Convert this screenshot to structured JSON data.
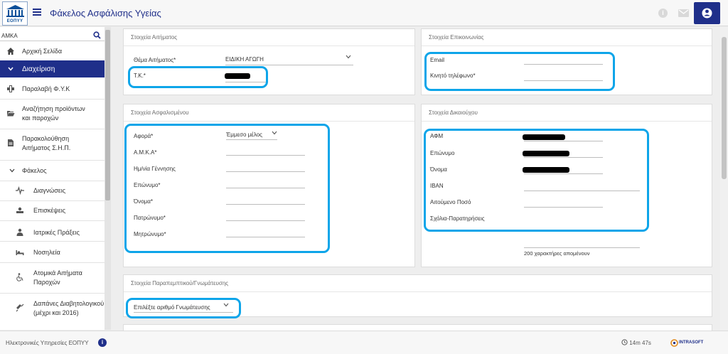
{
  "app": {
    "logo_text": "ΕΟΠΥΥ",
    "title": "Φάκελος Ασφάλισης Υγείας"
  },
  "sidebar": {
    "search_label": "ΑΜΚΑ",
    "items": [
      {
        "label": "Αρχική Σελίδα",
        "icon": "home-icon"
      },
      {
        "label": "Διαχείριση",
        "icon": "chevron-down-icon"
      },
      {
        "label": "Παραλαβή Φ.Υ.Κ",
        "icon": "pharmacy-icon"
      },
      {
        "label_line1": "Αναζήτηση προϊόντων",
        "label_line2": "και παροχών",
        "icon": "folder-open-icon"
      },
      {
        "label_line1": "Παρακολούθηση",
        "label_line2": "Αιτήματος Σ.Η.Π.",
        "icon": "document-icon"
      },
      {
        "label": "Φάκελος",
        "icon": "chevron-down-icon"
      },
      {
        "label": "Διαγνώσεις",
        "icon": "pulse-icon"
      },
      {
        "label": "Επισκέψεις",
        "icon": "visit-icon"
      },
      {
        "label": "Ιατρικές Πράξεις",
        "icon": "medical-acts-icon"
      },
      {
        "label": "Νοσηλεία",
        "icon": "bed-icon"
      },
      {
        "label_line1": "Ατομικά Αιτήματα",
        "label_line2": "Παροχών",
        "icon": "wheelchair-icon"
      },
      {
        "label_line1": "Δαπάνες Διαβητολογικού",
        "label_line2": "(μέχρι και 2016)",
        "icon": "syringe-icon"
      }
    ]
  },
  "request": {
    "title": "Στοιχεία Αιτήματος",
    "subject_label": "Θέμα Αιτήματος*",
    "subject_value": "ΕΙΔΙΚΗ ΑΓΩΓΗ",
    "postal_label": "Τ.Κ.*"
  },
  "contact": {
    "title": "Στοιχεία Επικοινωνίας",
    "email_label": "Email",
    "mobile_label": "Κινητό τηλέφωνο*"
  },
  "insured": {
    "title": "Στοιχεία Ασφαλισμένου",
    "concerns_label": "Αφορά*",
    "concerns_value": "Έμμεσο μέλος",
    "fields": [
      "Α.Μ.Κ.Α*",
      "Ημ/νία Γέννησης",
      "Επώνυμο*",
      "Όνομα*",
      "Πατρώνυμο*",
      "Μητρώνυμο*"
    ]
  },
  "beneficiary": {
    "title": "Στοιχεία Δικαιούχου",
    "fields": [
      "ΑΦΜ",
      "Επώνυμο",
      "Όνομα",
      "IBAN",
      "Αιτούμενο Ποσό",
      "Σχόλια-Παρατηρήσεις"
    ],
    "chars_left": "200 χαρακτήρες απομένουν"
  },
  "referral": {
    "title": "Στοιχεία Παραπεμπτικού/Γνωμάτευσης",
    "select_label": "Επιλέξτε αριθμό Γνωμάτευσης"
  },
  "footer": {
    "text": "Ηλεκτρονικές Υπηρεσίες ΕΟΠΥΥ",
    "info": "i",
    "timer": "14m 47s",
    "brand": "INTRASOFT"
  },
  "topbar": {
    "info": "i"
  },
  "colors": {
    "primary": "#1f2f8a",
    "highlight": "#0ea5e9"
  }
}
